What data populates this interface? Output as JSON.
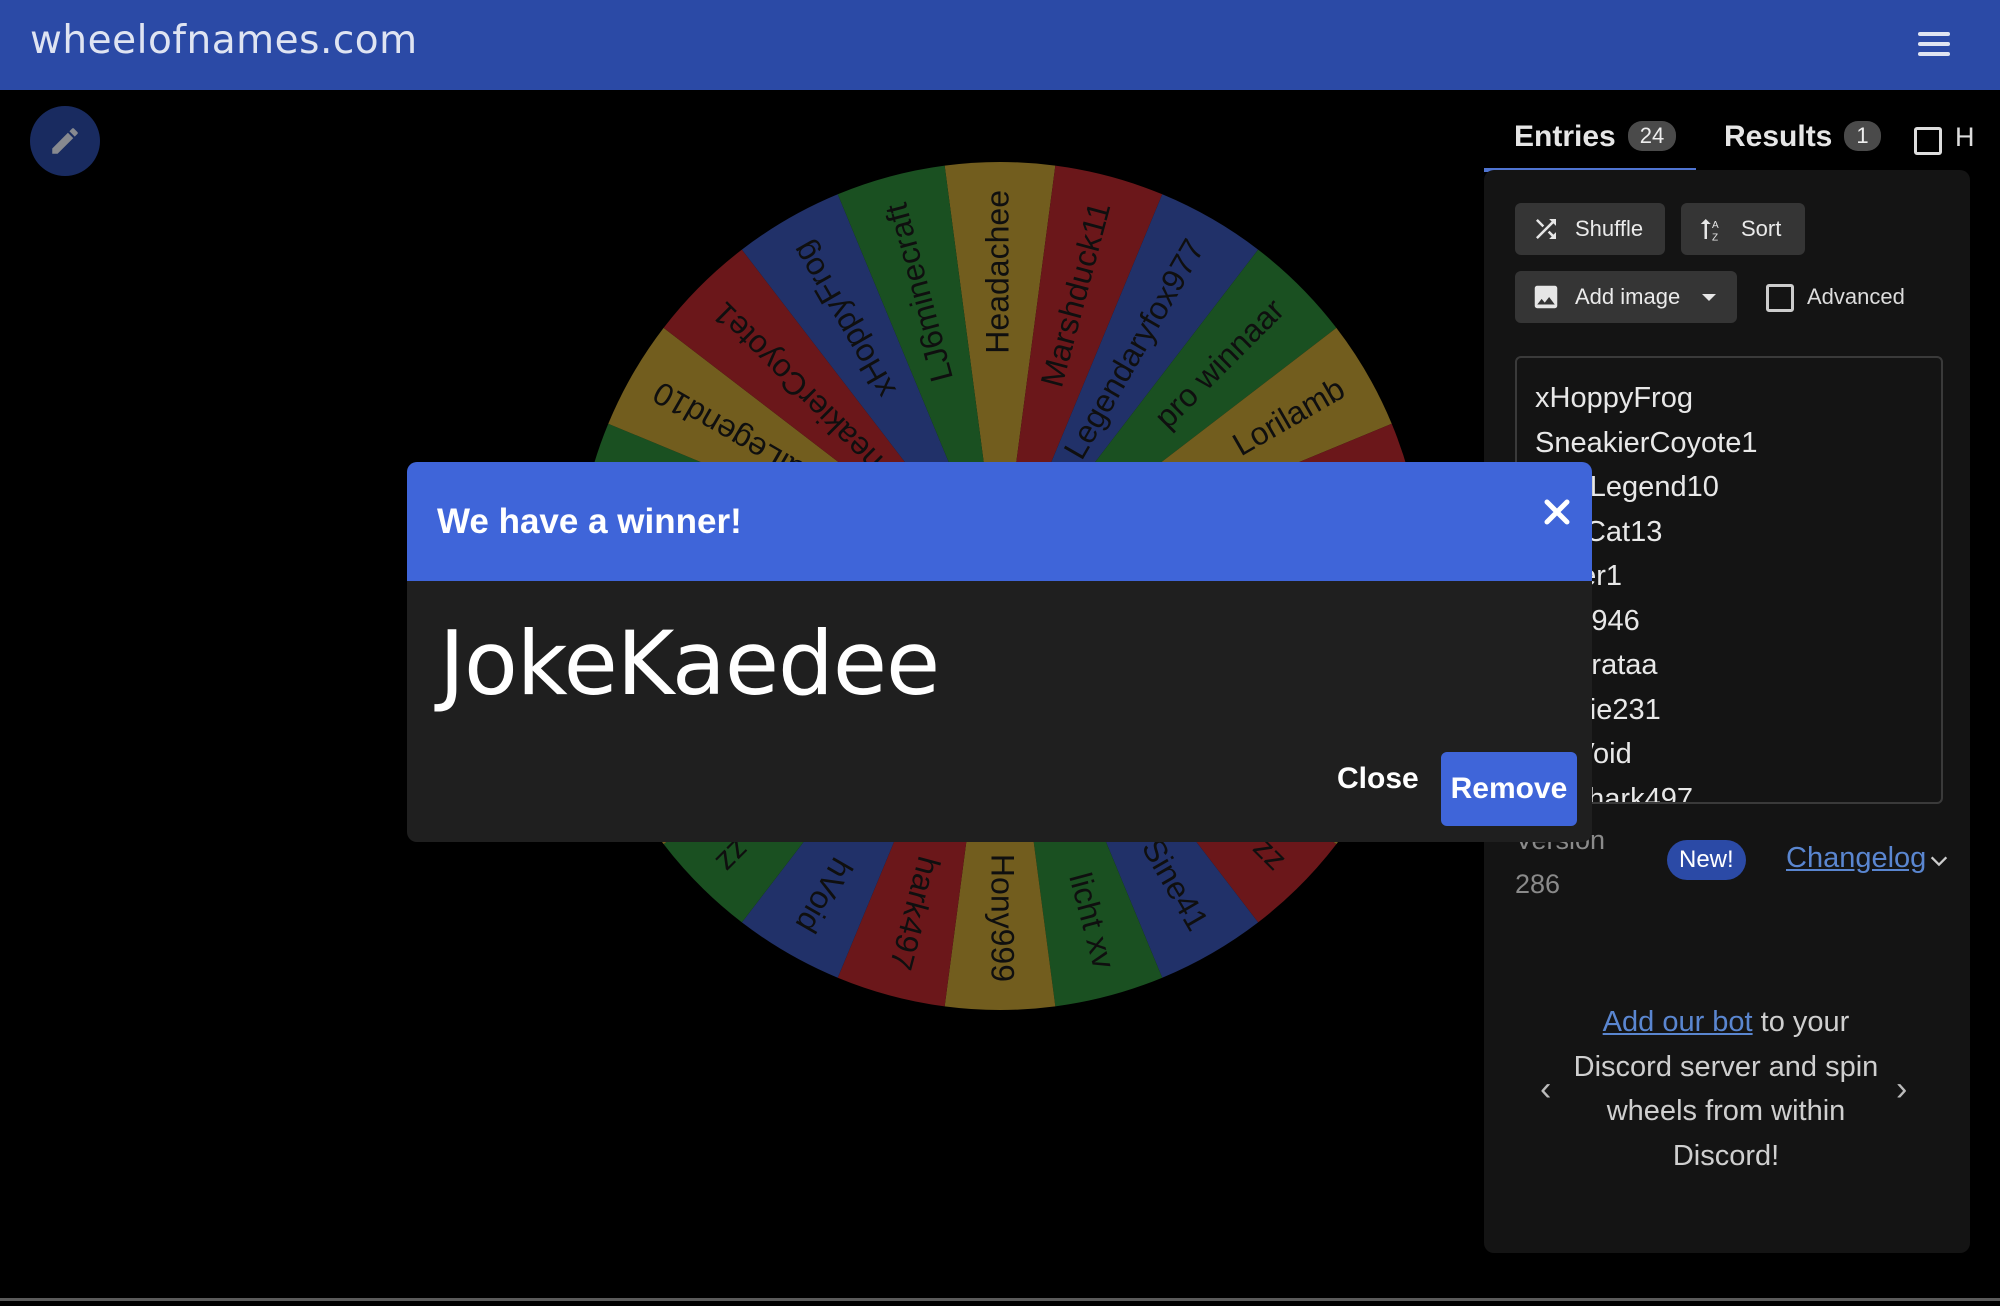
{
  "header": {
    "site_title": "wheelofnames.com"
  },
  "wheel": {
    "segments": [
      {
        "label": "Headachee",
        "color": "#c4a035"
      },
      {
        "label": "Marshduck11",
        "color": "#b8292e"
      },
      {
        "label": "Legendaryfox977",
        "color": "#3a55b5"
      },
      {
        "label": "pro winnaar",
        "color": "#2e8b3a"
      },
      {
        "label": "Lorilamb",
        "color": "#c4a035"
      },
      {
        "label": "",
        "color": "#b8292e"
      },
      {
        "label": "",
        "color": "#3a55b5"
      },
      {
        "label": "",
        "color": "#2e8b3a"
      },
      {
        "label": "",
        "color": "#c4a035"
      },
      {
        "label": "zz",
        "color": "#b8292e"
      },
      {
        "label": "Sine41",
        "color": "#3a55b5"
      },
      {
        "label": "licht xv",
        "color": "#2e8b3a"
      },
      {
        "label": "Hony999",
        "color": "#c4a035"
      },
      {
        "label": "hark497",
        "color": "#b8292e"
      },
      {
        "label": "hVoid",
        "color": "#3a55b5"
      },
      {
        "label": "zz",
        "color": "#2e8b3a"
      },
      {
        "label": "",
        "color": "#c4a035"
      },
      {
        "label": "",
        "color": "#b8292e"
      },
      {
        "label": "",
        "color": "#3a55b5"
      },
      {
        "label": "",
        "color": "#2e8b3a"
      },
      {
        "label": "aiLegend10",
        "color": "#c4a035"
      },
      {
        "label": "SneakierCoyote1",
        "color": "#b8292e"
      },
      {
        "label": "xHoppyFrog",
        "color": "#3a55b5"
      },
      {
        "label": "LJ6minecraft",
        "color": "#2e8b3a"
      }
    ]
  },
  "tabs": {
    "entries": {
      "label": "Entries",
      "count": "24"
    },
    "results": {
      "label": "Results",
      "count": "1"
    },
    "hide_label": "H"
  },
  "toolbar": {
    "shuffle_label": "Shuffle",
    "sort_label": "Sort",
    "add_image_label": "Add image",
    "advanced_label": "Advanced"
  },
  "entries": [
    "xHoppyFrog",
    "SneakierCoyote1",
    "...talLegend10",
    "...erCat13",
    "...wer1",
    "...n2946",
    "...derataa",
    "...ypie231",
    "...hVoid",
    "...rShark497"
  ],
  "version": {
    "line1": "Version",
    "line2": "286",
    "new_badge": "New!",
    "changelog": "Changelog"
  },
  "promo": {
    "link": "Add our bot",
    "text": " to your Discord server and spin wheels from within Discord!"
  },
  "modal": {
    "title": "We have a winner!",
    "winner": "JokeKaedee",
    "close_label": "Close",
    "remove_label": "Remove"
  },
  "colors": {
    "brand": "#2b4aa6",
    "modal_header": "#3f65d9",
    "link": "#5a86d0"
  }
}
